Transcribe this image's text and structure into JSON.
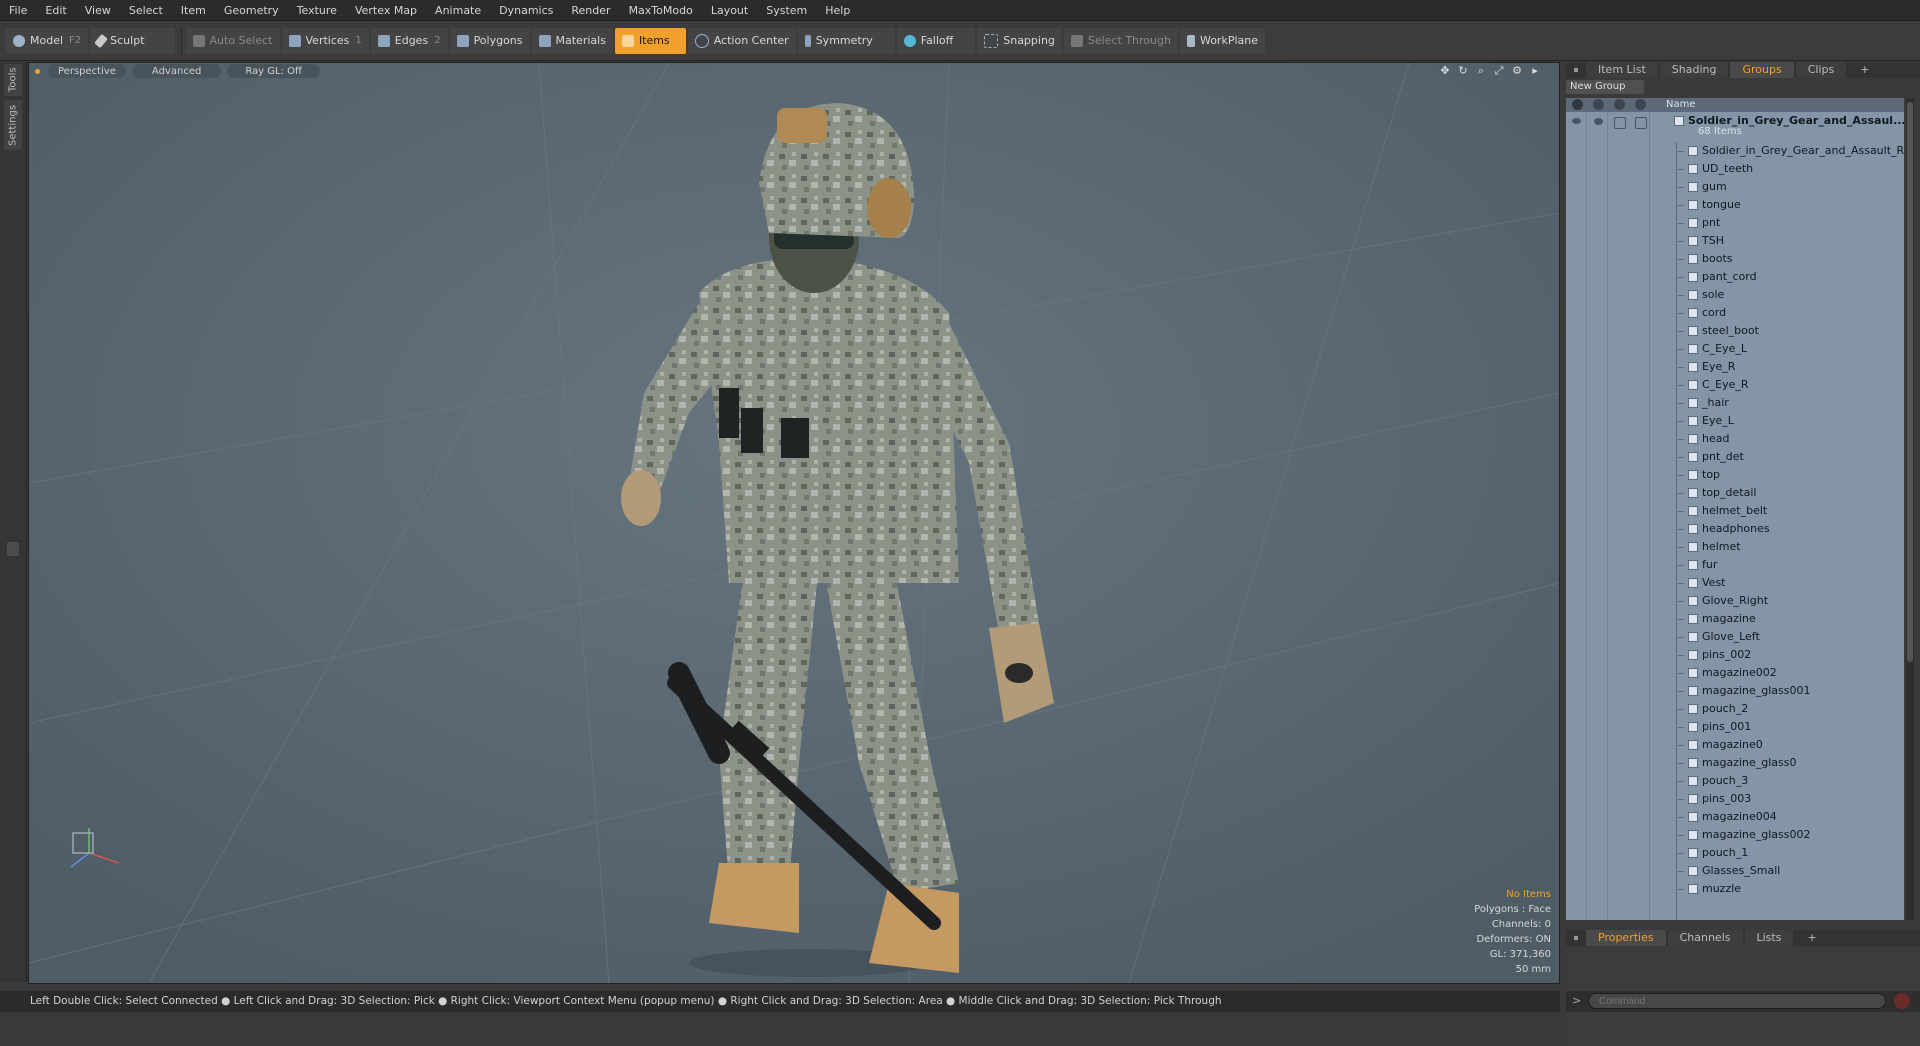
{
  "menu": [
    "File",
    "Edit",
    "View",
    "Select",
    "Item",
    "Geometry",
    "Texture",
    "Vertex Map",
    "Animate",
    "Dynamics",
    "Render",
    "MaxToModo",
    "Layout",
    "System",
    "Help"
  ],
  "toolbar": {
    "model": "Model",
    "model_key": "F2",
    "sculpt": "Sculpt",
    "auto_select": "Auto Select",
    "vertices": "Vertices",
    "vertices_key": "1",
    "edges": "Edges",
    "edges_key": "2",
    "polygons": "Polygons",
    "materials": "Materials",
    "items": "Items",
    "action_center": "Action Center",
    "symmetry": "Symmetry",
    "falloff": "Falloff",
    "snapping": "Snapping",
    "select_through": "Select Through",
    "workplane": "WorkPlane"
  },
  "left_tabs": [
    "Tools",
    "Settings"
  ],
  "viewport": {
    "view_mode": "Perspective",
    "advanced": "Advanced",
    "ray_gl": "Ray GL: Off",
    "info": {
      "no_items": "No Items",
      "polygons": "Polygons : Face",
      "channels": "Channels: 0",
      "deformers": "Deformers: ON",
      "gl": "GL: 371,360",
      "focal": "50 mm"
    }
  },
  "panel": {
    "tabs": [
      "Item List",
      "Shading",
      "Groups",
      "Clips",
      "+"
    ],
    "active_tab": "Groups",
    "new_group": "New Group",
    "column_name": "Name",
    "group_name": "Soldier_in_Grey_Gear_and_Assaul...",
    "group_count": "68 Items",
    "items": [
      "Soldier_in_Grey_Gear_and_Assault_Ri...",
      "UD_teeth",
      "gum",
      "tongue",
      "pnt",
      "TSH",
      "boots",
      "pant_cord",
      "sole",
      "cord",
      "steel_boot",
      "C_Eye_L",
      "Eye_R",
      "C_Eye_R",
      "_hair",
      "Eye_L",
      "head",
      "pnt_det",
      "top",
      "top_detail",
      "helmet_belt",
      "headphones",
      "helmet",
      "fur",
      "Vest",
      "Glove_Right",
      "magazine",
      "Glove_Left",
      "pins_002",
      "magazine002",
      "magazine_glass001",
      "pouch_2",
      "pins_001",
      "magazine0",
      "magazine_glass0",
      "pouch_3",
      "pins_003",
      "magazine004",
      "magazine_glass002",
      "pouch_1",
      "Glasses_Small",
      "muzzle"
    ],
    "bottom_tabs": [
      "Properties",
      "Channels",
      "Lists",
      "+"
    ],
    "bottom_active": "Properties"
  },
  "status": "Left Double Click: Select Connected ● Left Click and Drag: 3D Selection: Pick ● Right Click: Viewport Context Menu (popup menu) ● Right Click and Drag: 3D Selection: Area ● Middle Click and Drag: 3D Selection: Pick Through",
  "command": {
    "placeholder": "Command",
    "prompt": ">"
  },
  "colors": {
    "accent": "#f1a02b",
    "viewport_bg": "#5a6872",
    "list_bg": "#8595a8"
  }
}
